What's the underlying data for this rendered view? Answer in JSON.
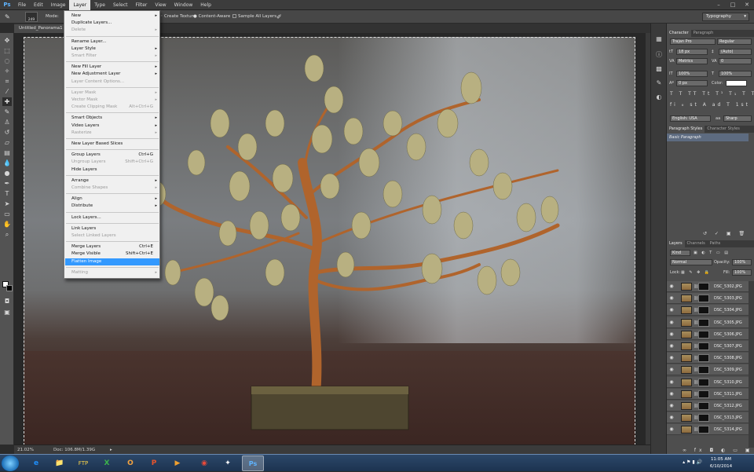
{
  "app": {
    "logo": "Ps"
  },
  "menubar": {
    "items": [
      "File",
      "Edit",
      "Image",
      "Layer",
      "Type",
      "Select",
      "Filter",
      "View",
      "Window",
      "Help"
    ],
    "window_controls": [
      "–",
      "□",
      "✕"
    ]
  },
  "options_bar": {
    "brush_size": "249",
    "mode_label": "Mode:",
    "create_texture": "Create Texture",
    "content_aware": "Content-Aware",
    "sample_all_layers": "Sample All Layers",
    "workspace": "Typography"
  },
  "document": {
    "tab_title": "Untitled_Panorama1 @"
  },
  "layer_menu": {
    "items": [
      {
        "label": "New",
        "submenu": true
      },
      {
        "label": "Duplicate Layers..."
      },
      {
        "label": "Delete",
        "disabled": true,
        "submenu": true
      },
      {
        "label": "Rename Layer..."
      },
      {
        "label": "Layer Style",
        "submenu": true
      },
      {
        "label": "Smart Filter",
        "disabled": true,
        "submenu": true
      },
      {
        "label": "New Fill Layer",
        "submenu": true
      },
      {
        "label": "New Adjustment Layer",
        "submenu": true
      },
      {
        "label": "Layer Content Options...",
        "disabled": true
      },
      {
        "label": "Layer Mask",
        "disabled": true,
        "submenu": true
      },
      {
        "label": "Vector Mask",
        "disabled": true,
        "submenu": true
      },
      {
        "label": "Create Clipping Mask",
        "disabled": true,
        "shortcut": "Alt+Ctrl+G"
      },
      {
        "label": "Smart Objects",
        "submenu": true
      },
      {
        "label": "Video Layers",
        "submenu": true
      },
      {
        "label": "Rasterize",
        "disabled": true,
        "submenu": true
      },
      {
        "label": "New Layer Based Slices"
      },
      {
        "label": "Group Layers",
        "shortcut": "Ctrl+G"
      },
      {
        "label": "Ungroup Layers",
        "disabled": true,
        "shortcut": "Shift+Ctrl+G"
      },
      {
        "label": "Hide Layers"
      },
      {
        "label": "Arrange",
        "submenu": true
      },
      {
        "label": "Combine Shapes",
        "disabled": true,
        "submenu": true
      },
      {
        "label": "Align",
        "submenu": true
      },
      {
        "label": "Distribute",
        "submenu": true
      },
      {
        "label": "Lock Layers..."
      },
      {
        "label": "Link Layers"
      },
      {
        "label": "Select Linked Layers",
        "disabled": true
      },
      {
        "label": "Merge Layers",
        "shortcut": "Ctrl+E"
      },
      {
        "label": "Merge Visible",
        "shortcut": "Shift+Ctrl+E"
      },
      {
        "label": "Flatten Image",
        "highlighted": true
      },
      {
        "label": "Matting",
        "disabled": true,
        "submenu": true
      }
    ]
  },
  "status_bar": {
    "zoom": "21.02%",
    "doc_size": "Doc: 106.8M/1.39G"
  },
  "character_panel": {
    "tabs": [
      "Character",
      "Paragraph"
    ],
    "font_family": "Trajan Pro",
    "font_style": "Regular",
    "font_size": "18 px",
    "leading": "(Auto)",
    "kerning": "Metrics",
    "tracking": "0",
    "vertical_scale": "100%",
    "horizontal_scale": "100%",
    "baseline_shift": "0 px",
    "color_label": "Color:",
    "language": "English: USA",
    "antialias_prefix": "aa",
    "antialias": "Sharp"
  },
  "paragraph_styles_panel": {
    "tabs": [
      "Paragraph Styles",
      "Character Styles"
    ],
    "style": "Basic Paragraph"
  },
  "layers_panel": {
    "tabs": [
      "Layers",
      "Channels",
      "Paths"
    ],
    "filter": "Kind",
    "blend_mode": "Normal",
    "opacity_label": "Opacity:",
    "opacity": "100%",
    "lock_label": "Lock:",
    "fill_label": "Fill:",
    "fill": "100%",
    "layers": [
      "DSC_5302.JPG",
      "DSC_5303.JPG",
      "DSC_5304.JPG",
      "DSC_5305.JPG",
      "DSC_5306.JPG",
      "DSC_5307.JPG",
      "DSC_5308.JPG",
      "DSC_5309.JPG",
      "DSC_5310.JPG",
      "DSC_5311.JPG",
      "DSC_5312.JPG",
      "DSC_5313.JPG",
      "DSC_5314.JPG"
    ]
  },
  "taskbar": {
    "time": "11:05 AM",
    "date": "6/10/2014"
  },
  "colors": {
    "menu_highlight": "#3399ff",
    "photoshop_blue": "#5fb4ff"
  }
}
